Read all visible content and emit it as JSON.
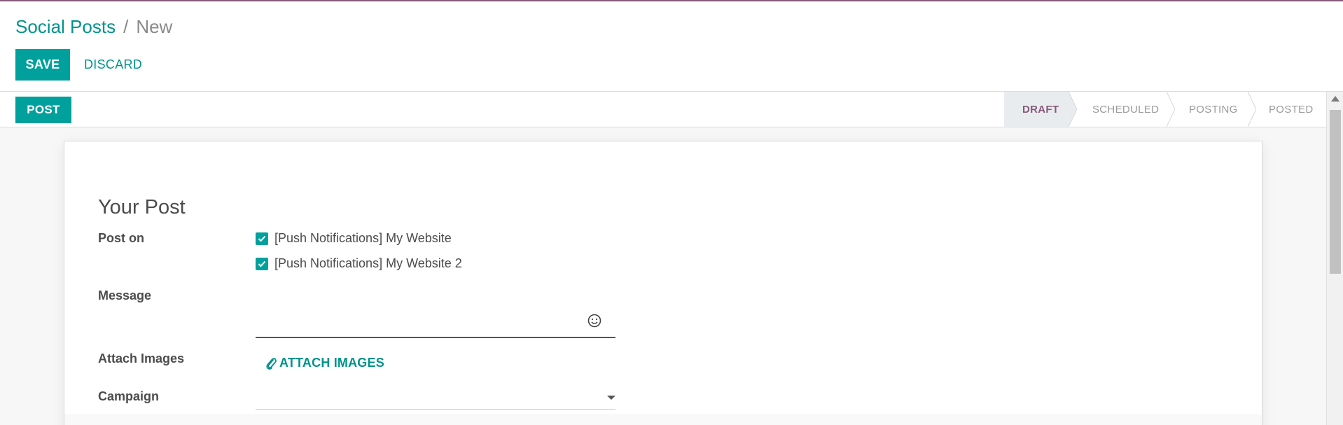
{
  "breadcrumb": {
    "parent": "Social Posts",
    "separator": "/",
    "current": "New"
  },
  "toolbar": {
    "save_label": "SAVE",
    "discard_label": "DISCARD"
  },
  "statusbar": {
    "post_label": "POST",
    "stages": [
      {
        "label": "DRAFT",
        "active": true
      },
      {
        "label": "SCHEDULED",
        "active": false
      },
      {
        "label": "POSTING",
        "active": false
      },
      {
        "label": "POSTED",
        "active": false
      }
    ]
  },
  "form": {
    "section_title": "Your Post",
    "post_on": {
      "label": "Post on",
      "options": [
        {
          "label": "[Push Notifications] My Website",
          "checked": true
        },
        {
          "label": "[Push Notifications] My Website 2",
          "checked": true
        }
      ]
    },
    "message": {
      "label": "Message",
      "value": ""
    },
    "attach_images": {
      "label": "Attach Images",
      "button_label": "ATTACH IMAGES"
    },
    "campaign": {
      "label": "Campaign",
      "value": ""
    }
  },
  "colors": {
    "primary": "#00a09d",
    "link": "#00928c",
    "brand_bar": "#875a7b",
    "active_stage": "#875a7b"
  },
  "icons": {
    "checkbox": "checkmark-icon",
    "emoji": "smiley-icon",
    "attach": "paperclip-icon",
    "dropdown": "caret-down-icon"
  }
}
